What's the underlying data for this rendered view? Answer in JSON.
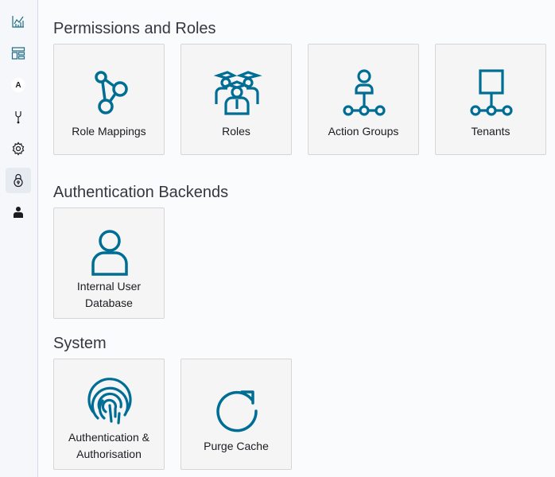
{
  "colors": {
    "accent": "#006d95",
    "sidebar_bg": "#f5f7fa",
    "tile_bg": "#f5f5f5"
  },
  "sidebar": {
    "items": [
      {
        "icon": "visualize-chart-icon"
      },
      {
        "icon": "dashboard-icon"
      },
      {
        "icon": "avatar-letter-icon",
        "letter": "A"
      },
      {
        "icon": "dev-tools-icon"
      },
      {
        "icon": "gear-icon"
      },
      {
        "icon": "security-lock-icon"
      },
      {
        "icon": "user-icon"
      }
    ]
  },
  "sections": {
    "permissions": {
      "title": "Permissions and Roles",
      "tiles": [
        {
          "label": "Role Mappings",
          "icon": "role-mappings-icon"
        },
        {
          "label": "Roles",
          "icon": "roles-icon"
        },
        {
          "label": "Action Groups",
          "icon": "action-groups-icon"
        },
        {
          "label": "Tenants",
          "icon": "tenants-icon"
        }
      ]
    },
    "auth": {
      "title": "Authentication Backends",
      "tiles": [
        {
          "label_line1": "Internal User",
          "label_line2": "Database",
          "icon": "internal-user-icon"
        }
      ]
    },
    "system": {
      "title": "System",
      "tiles": [
        {
          "label_line1": "Authentication &",
          "label_line2": "Authorisation",
          "icon": "fingerprint-icon"
        },
        {
          "label": "Purge Cache",
          "icon": "refresh-icon"
        }
      ]
    }
  }
}
